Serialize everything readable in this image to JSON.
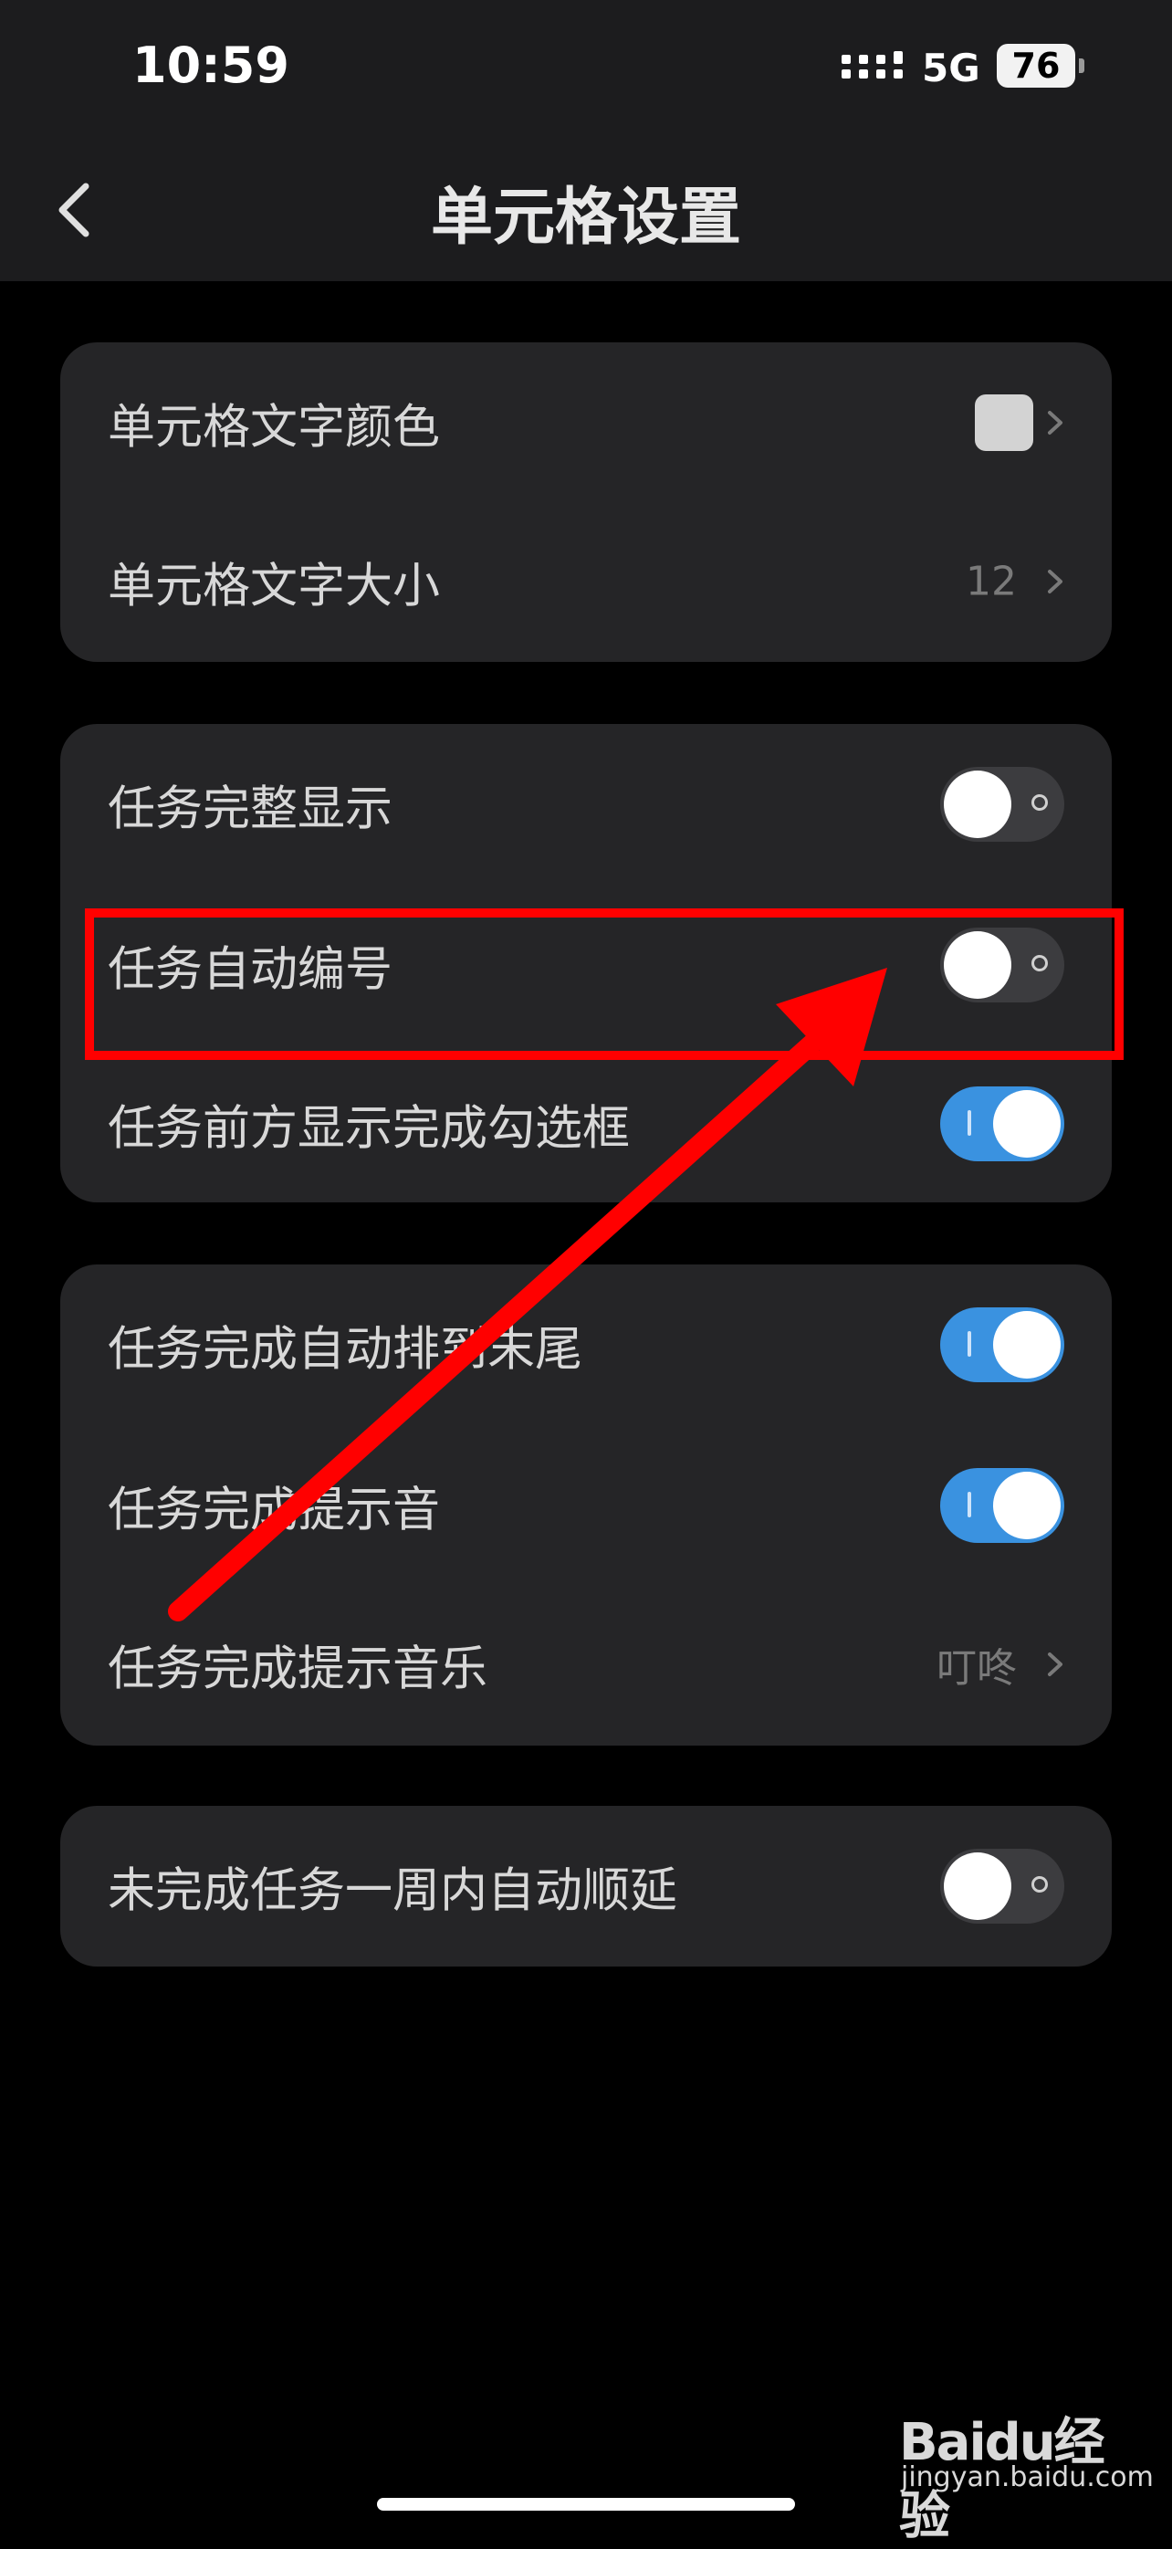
{
  "status_bar": {
    "time": "10:59",
    "network": "5G",
    "battery": "76"
  },
  "header": {
    "title": "单元格设置"
  },
  "groups": [
    {
      "rows": [
        {
          "label": "单元格文字颜色",
          "type": "color",
          "swatch_color": "#d3d3d3"
        },
        {
          "label": "单元格文字大小",
          "type": "value",
          "value": "12"
        }
      ]
    },
    {
      "rows": [
        {
          "label": "任务完整显示",
          "type": "toggle",
          "on": false
        },
        {
          "label": "任务自动编号",
          "type": "toggle",
          "on": false,
          "highlighted": true
        },
        {
          "label": "任务前方显示完成勾选框",
          "type": "toggle",
          "on": true
        }
      ]
    },
    {
      "rows": [
        {
          "label": "任务完成自动排到末尾",
          "type": "toggle",
          "on": true
        },
        {
          "label": "任务完成提示音",
          "type": "toggle",
          "on": true
        },
        {
          "label": "任务完成提示音乐",
          "type": "value",
          "value": "叮咚"
        }
      ]
    },
    {
      "rows": [
        {
          "label": "未完成任务一周内自动顺延",
          "type": "toggle",
          "on": false
        }
      ]
    }
  ],
  "annotation": {
    "color": "#ff0000"
  },
  "watermark": {
    "brand": "Baidu经验",
    "url": "jingyan.baidu.com"
  },
  "colors": {
    "toggle_on": "#3a92e0",
    "toggle_off": "#3c3c3f",
    "card": "#252527",
    "background": "#000000"
  }
}
